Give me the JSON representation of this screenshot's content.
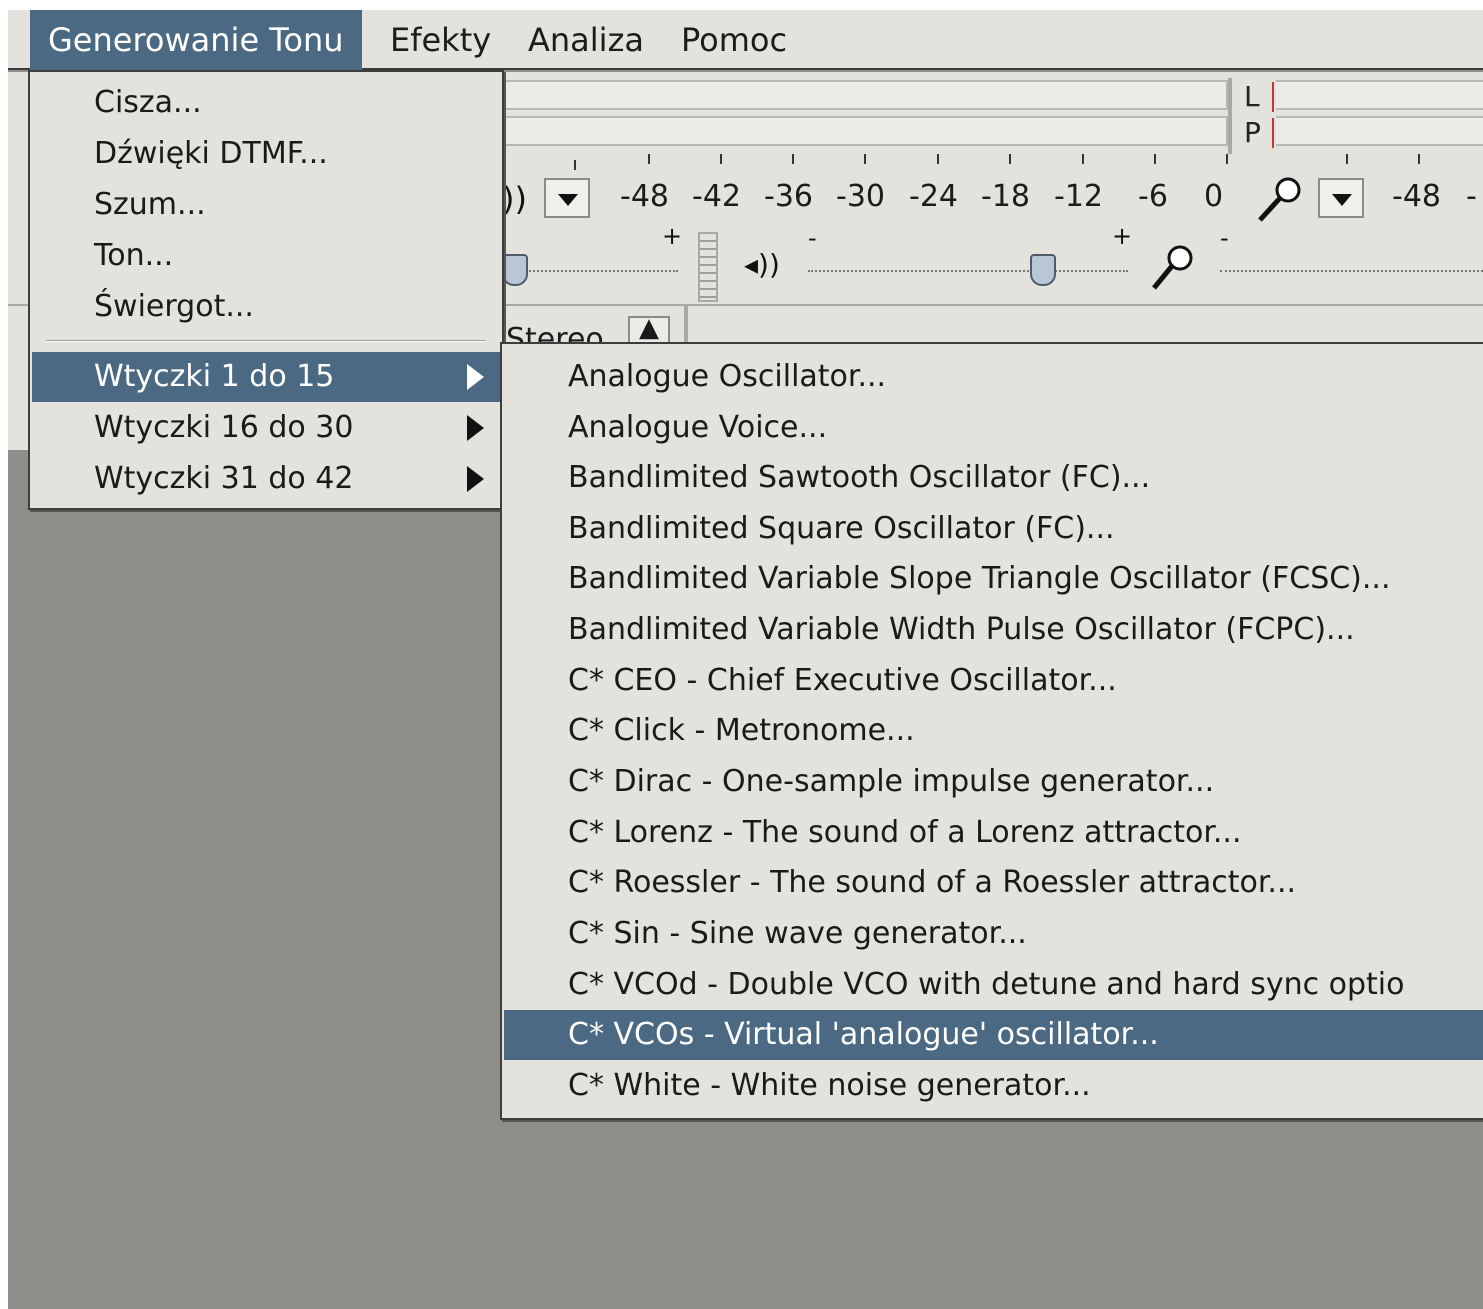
{
  "menubar": {
    "items": [
      {
        "label": "Generowanie Tonu"
      },
      {
        "label": "Efekty"
      },
      {
        "label": "Analiza"
      },
      {
        "label": "Pomoc"
      }
    ]
  },
  "meter": {
    "left_label": "L",
    "right_label": "P",
    "scale_playback": [
      "-48",
      "-42",
      "-36",
      "-30",
      "-24",
      "-18",
      "-12",
      "-6",
      "0"
    ],
    "scale_record": [
      "-48",
      "-"
    ],
    "playback_icon": "speaker-icon",
    "record_icon": "microphone-icon"
  },
  "mixer": {
    "minus": "-",
    "plus": "+"
  },
  "track": {
    "channel_label": "Stereo"
  },
  "generate_menu": {
    "items": [
      {
        "label": "Cisza..."
      },
      {
        "label": "Dźwięki DTMF..."
      },
      {
        "label": "Szum..."
      },
      {
        "label": "Ton..."
      },
      {
        "label": "Świergot..."
      }
    ],
    "submenus": [
      {
        "label": "Wtyczki 1 do 15",
        "highlighted": true
      },
      {
        "label": "Wtyczki 16 do 30"
      },
      {
        "label": "Wtyczki 31 do 42"
      }
    ]
  },
  "plugins_submenu": {
    "items": [
      {
        "label": "Analogue Oscillator..."
      },
      {
        "label": "Analogue Voice..."
      },
      {
        "label": "Bandlimited Sawtooth Oscillator (FC)..."
      },
      {
        "label": "Bandlimited Square Oscillator (FC)..."
      },
      {
        "label": "Bandlimited Variable Slope Triangle Oscillator (FCSC)..."
      },
      {
        "label": "Bandlimited Variable Width Pulse Oscillator (FCPC)..."
      },
      {
        "label": "C* CEO - Chief Executive Oscillator..."
      },
      {
        "label": "C* Click - Metronome..."
      },
      {
        "label": "C* Dirac - One-sample impulse generator..."
      },
      {
        "label": "C* Lorenz - The sound of a Lorenz attractor..."
      },
      {
        "label": "C* Roessler - The sound of a Roessler attractor..."
      },
      {
        "label": "C* Sin - Sine wave generator..."
      },
      {
        "label": "C* VCOd - Double VCO with detune and hard sync optio"
      },
      {
        "label": "C* VCOs - Virtual 'analogue' oscillator...",
        "highlighted": true
      },
      {
        "label": "C* White - White noise generator..."
      }
    ]
  },
  "colors": {
    "highlight": "#4b6983",
    "menu_bg": "#e3e2dd",
    "workspace": "#8f8e8a"
  }
}
